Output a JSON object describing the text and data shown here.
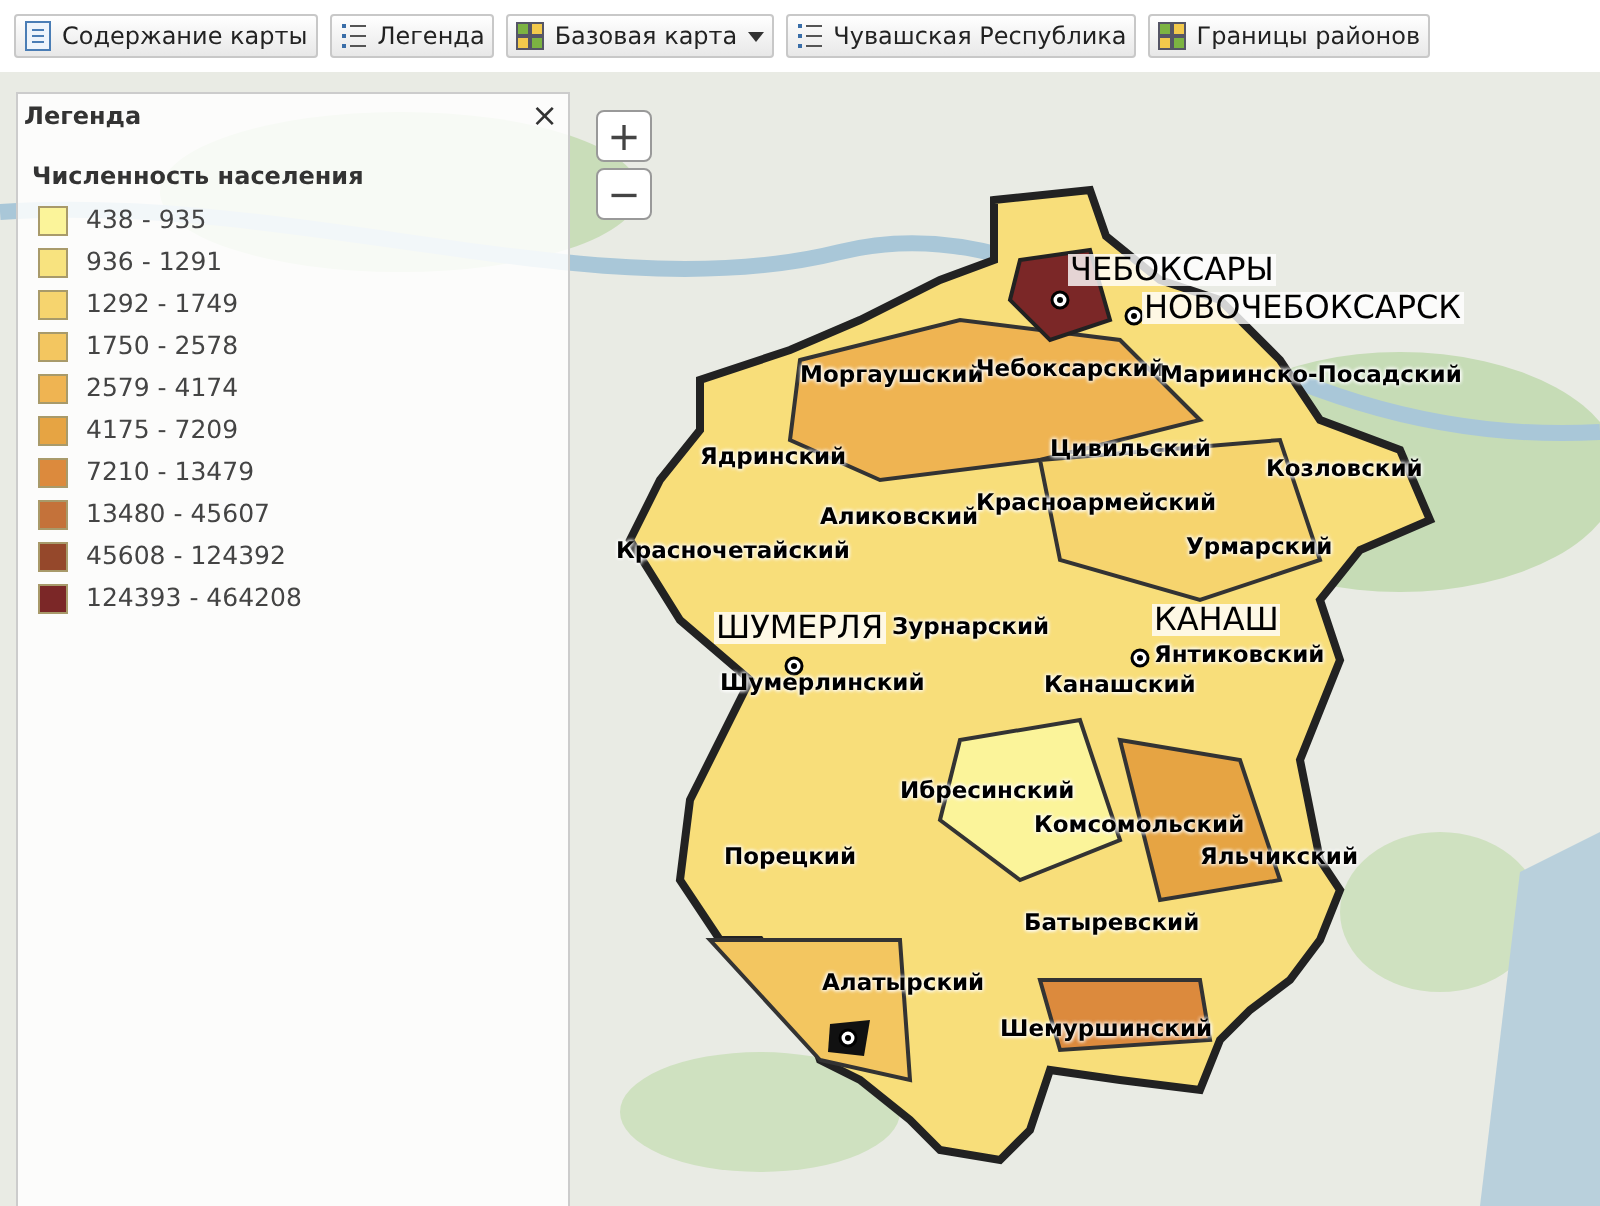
{
  "toolbar": [
    {
      "label": "Содержание карты",
      "dropdown": false
    },
    {
      "label": "Легенда",
      "dropdown": false
    },
    {
      "label": "Базовая карта",
      "dropdown": true
    },
    {
      "label": "Чувашская Республика",
      "dropdown": false
    },
    {
      "label": "Границы районов",
      "dropdown": false
    }
  ],
  "legend": {
    "title": "Легенда",
    "close": "×",
    "layer": "Численность населения",
    "items": [
      {
        "label": "438 - 935",
        "color": "#fbf49a"
      },
      {
        "label": "936 - 1291",
        "color": "#f8e37f"
      },
      {
        "label": "1292 - 1749",
        "color": "#f6d46e"
      },
      {
        "label": "1750 - 2578",
        "color": "#f3c660"
      },
      {
        "label": "2579 - 4174",
        "color": "#efb452"
      },
      {
        "label": "4175 - 7209",
        "color": "#e6a443"
      },
      {
        "label": "7210 - 13479",
        "color": "#dc8a3d"
      },
      {
        "label": "13480 - 45607",
        "color": "#c4723a"
      },
      {
        "label": "45608 - 124392",
        "color": "#95482b"
      },
      {
        "label": "124393 - 464208",
        "color": "#7b2727"
      }
    ]
  },
  "zoom": {
    "in": "+",
    "out": "−"
  },
  "map_labels": [
    {
      "text": "ЧЕБОКСАРЫ",
      "kind": "city"
    },
    {
      "text": "НОВОЧЕБОКСАРСК",
      "kind": "city"
    },
    {
      "text": "Моргаушский",
      "kind": "district"
    },
    {
      "text": "Чебоксарский",
      "kind": "district"
    },
    {
      "text": "Мариинско-Посадский",
      "kind": "district"
    },
    {
      "text": "Ядринский",
      "kind": "district"
    },
    {
      "text": "Цивильский",
      "kind": "district"
    },
    {
      "text": "Козловский",
      "kind": "district"
    },
    {
      "text": "Аликовский",
      "kind": "district"
    },
    {
      "text": "Красноармейский",
      "kind": "district"
    },
    {
      "text": "Красночетайский",
      "kind": "district"
    },
    {
      "text": "Урмарский",
      "kind": "district"
    },
    {
      "text": "ШУМЕРЛЯ",
      "kind": "city"
    },
    {
      "text": "Зурнарский",
      "kind": "district"
    },
    {
      "text": "КАНАШ",
      "kind": "city"
    },
    {
      "text": "Янтиковский",
      "kind": "district"
    },
    {
      "text": "Шумерлинский",
      "kind": "district"
    },
    {
      "text": "Канашский",
      "kind": "district"
    },
    {
      "text": "Ибресинский",
      "kind": "district"
    },
    {
      "text": "Комсомольский",
      "kind": "district"
    },
    {
      "text": "Порецкий",
      "kind": "district"
    },
    {
      "text": "Яльчикский",
      "kind": "district"
    },
    {
      "text": "Батыревский",
      "kind": "district"
    },
    {
      "text": "Алатырский",
      "kind": "district"
    },
    {
      "text": "Шемуршинский",
      "kind": "district"
    }
  ]
}
